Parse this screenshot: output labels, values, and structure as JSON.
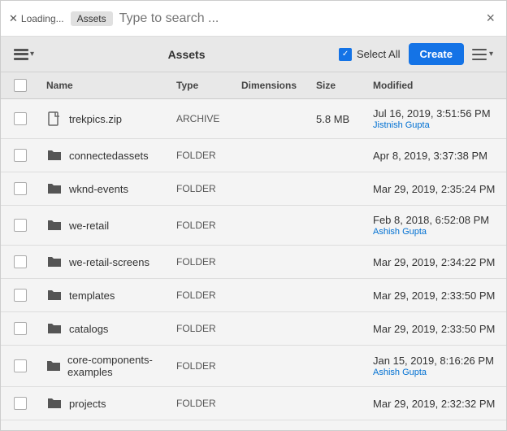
{
  "searchBar": {
    "closeLabel": "Loading...",
    "tabLabel": "Assets",
    "searchPlaceholder": "Type to search ...",
    "closeDialogLabel": "×"
  },
  "toolbar": {
    "title": "Assets",
    "selectAllLabel": "Select All",
    "createLabel": "Create",
    "layoutToggleTitle": "Layout",
    "listOptionsTitle": "List Options"
  },
  "table": {
    "columns": {
      "name": "Name",
      "type": "Type",
      "dimensions": "Dimensions",
      "size": "Size",
      "modified": "Modified"
    },
    "rows": [
      {
        "icon": "file",
        "name": "trekpics.zip",
        "type": "ARCHIVE",
        "dimensions": "",
        "size": "5.8 MB",
        "modified": "Jul 16, 2019, 3:51:56 PM",
        "modifiedBy": "Jistnish Gupta"
      },
      {
        "icon": "folder",
        "name": "connectedassets",
        "type": "FOLDER",
        "dimensions": "",
        "size": "",
        "modified": "Apr 8, 2019, 3:37:38 PM",
        "modifiedBy": ""
      },
      {
        "icon": "folder",
        "name": "wknd-events",
        "type": "FOLDER",
        "dimensions": "",
        "size": "",
        "modified": "Mar 29, 2019, 2:35:24 PM",
        "modifiedBy": ""
      },
      {
        "icon": "folder",
        "name": "we-retail",
        "type": "FOLDER",
        "dimensions": "",
        "size": "",
        "modified": "Feb 8, 2018, 6:52:08 PM",
        "modifiedBy": "Ashish Gupta"
      },
      {
        "icon": "folder",
        "name": "we-retail-screens",
        "type": "FOLDER",
        "dimensions": "",
        "size": "",
        "modified": "Mar 29, 2019, 2:34:22 PM",
        "modifiedBy": ""
      },
      {
        "icon": "folder",
        "name": "templates",
        "type": "FOLDER",
        "dimensions": "",
        "size": "",
        "modified": "Mar 29, 2019, 2:33:50 PM",
        "modifiedBy": ""
      },
      {
        "icon": "folder",
        "name": "catalogs",
        "type": "FOLDER",
        "dimensions": "",
        "size": "",
        "modified": "Mar 29, 2019, 2:33:50 PM",
        "modifiedBy": ""
      },
      {
        "icon": "folder",
        "name": "core-components-examples",
        "type": "FOLDER",
        "dimensions": "",
        "size": "",
        "modified": "Jan 15, 2019, 8:16:26 PM",
        "modifiedBy": "Ashish Gupta"
      },
      {
        "icon": "folder",
        "name": "projects",
        "type": "FOLDER",
        "dimensions": "",
        "size": "",
        "modified": "Mar 29, 2019, 2:32:32 PM",
        "modifiedBy": ""
      }
    ]
  }
}
